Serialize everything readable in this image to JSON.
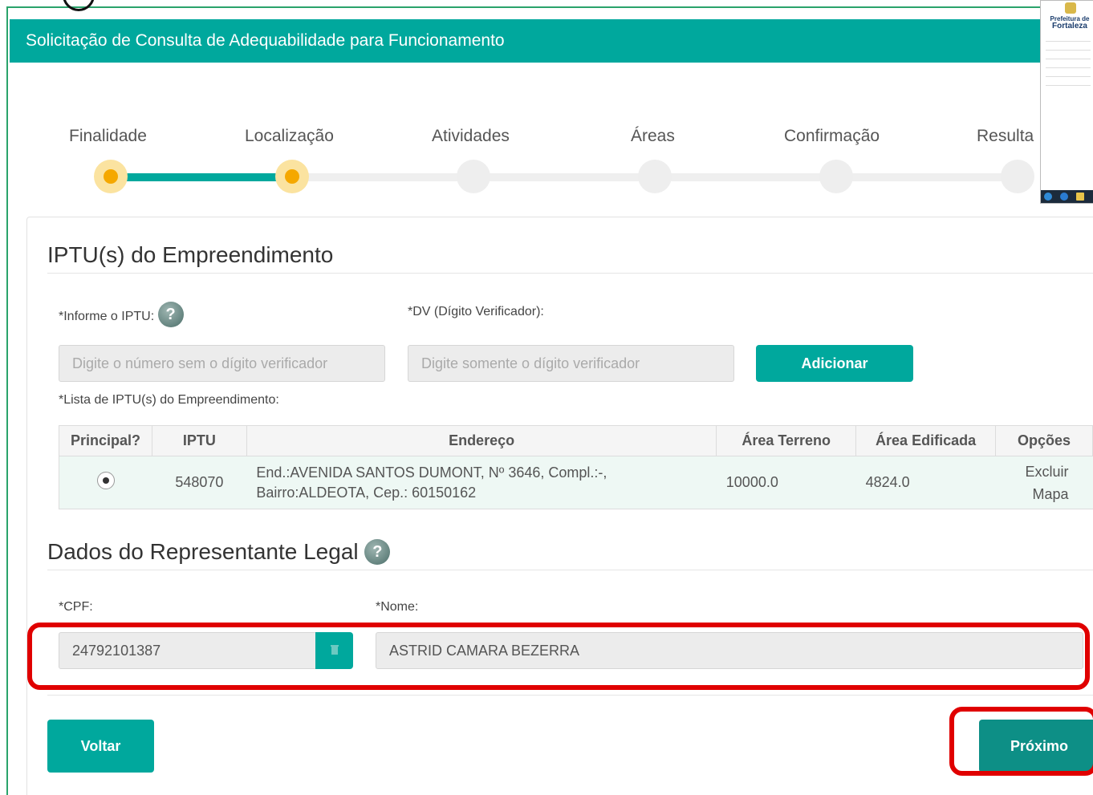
{
  "header": {
    "title": "Solicitação de Consulta de Adequabilidade para Funcionamento"
  },
  "steps": [
    {
      "label": "Finalidade",
      "state": "done"
    },
    {
      "label": "Localização",
      "state": "current"
    },
    {
      "label": "Atividades",
      "state": "pending"
    },
    {
      "label": "Áreas",
      "state": "pending"
    },
    {
      "label": "Confirmação",
      "state": "pending"
    },
    {
      "label": "Resulta",
      "state": "pending"
    }
  ],
  "thumbnail": {
    "title_line1": "Prefeitura de",
    "title_line2": "Fortaleza"
  },
  "iptu_section": {
    "title": "IPTU(s) do Empreendimento",
    "iptu_label": "*Informe o IPTU:",
    "iptu_placeholder": "Digite o número sem o dígito verificador",
    "dv_label": "*DV (Dígito Verificador):",
    "dv_placeholder": "Digite somente o dígito verificador",
    "add_button": "Adicionar",
    "list_label": "*Lista de IPTU(s) do Empreendimento:"
  },
  "table": {
    "headers": [
      "Principal?",
      "IPTU",
      "Endereço",
      "Área Terreno",
      "Área Edificada",
      "Opções"
    ],
    "rows": [
      {
        "iptu": "548070",
        "address_line1": "End.:AVENIDA SANTOS DUMONT, Nº 3646, Compl.:-,",
        "address_line2": "Bairro:ALDEOTA, Cep.: 60150162",
        "area_terreno": "10000.0",
        "area_edificada": "4824.0",
        "option_delete": "Excluir",
        "option_map": "Mapa"
      }
    ]
  },
  "rep_section": {
    "title": "Dados do Representante Legal",
    "cpf_label": "*CPF:",
    "cpf_value": "24792101387",
    "name_label": "*Nome:",
    "name_value": "ASTRID CAMARA BEZERRA"
  },
  "footer": {
    "back_button": "Voltar",
    "next_button": "Próximo"
  },
  "colors": {
    "brand": "#00a89d",
    "active_step": "#f5a800",
    "highlight": "#e00000"
  }
}
